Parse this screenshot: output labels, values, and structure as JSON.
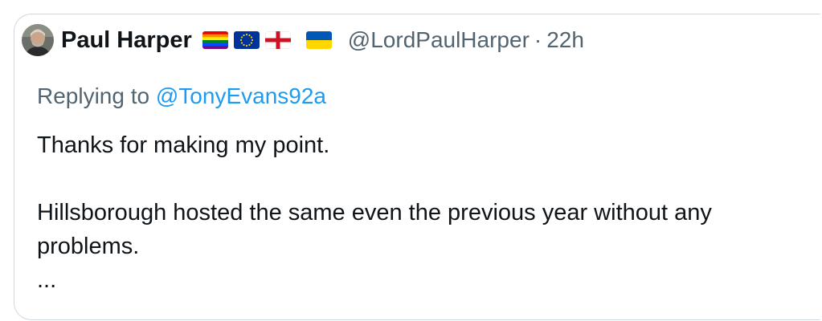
{
  "author": {
    "display_name": "Paul Harper",
    "handle": "@LordPaulHarper",
    "separator": "·",
    "time": "22h",
    "flags": [
      "rainbow-flag-icon",
      "eu-flag-icon",
      "england-flag-icon",
      "ukraine-flag-icon"
    ]
  },
  "reply": {
    "prefix": "Replying to",
    "mention": "@TonyEvans92a"
  },
  "body": {
    "line1": "Thanks for making my point.",
    "line2": "Hillsborough hosted the same even the previous year without any problems.",
    "ellipsis": "..."
  },
  "colors": {
    "text": "#0f1419",
    "muted": "#536471",
    "link": "#1d9bf0",
    "border": "#cfd9de"
  }
}
